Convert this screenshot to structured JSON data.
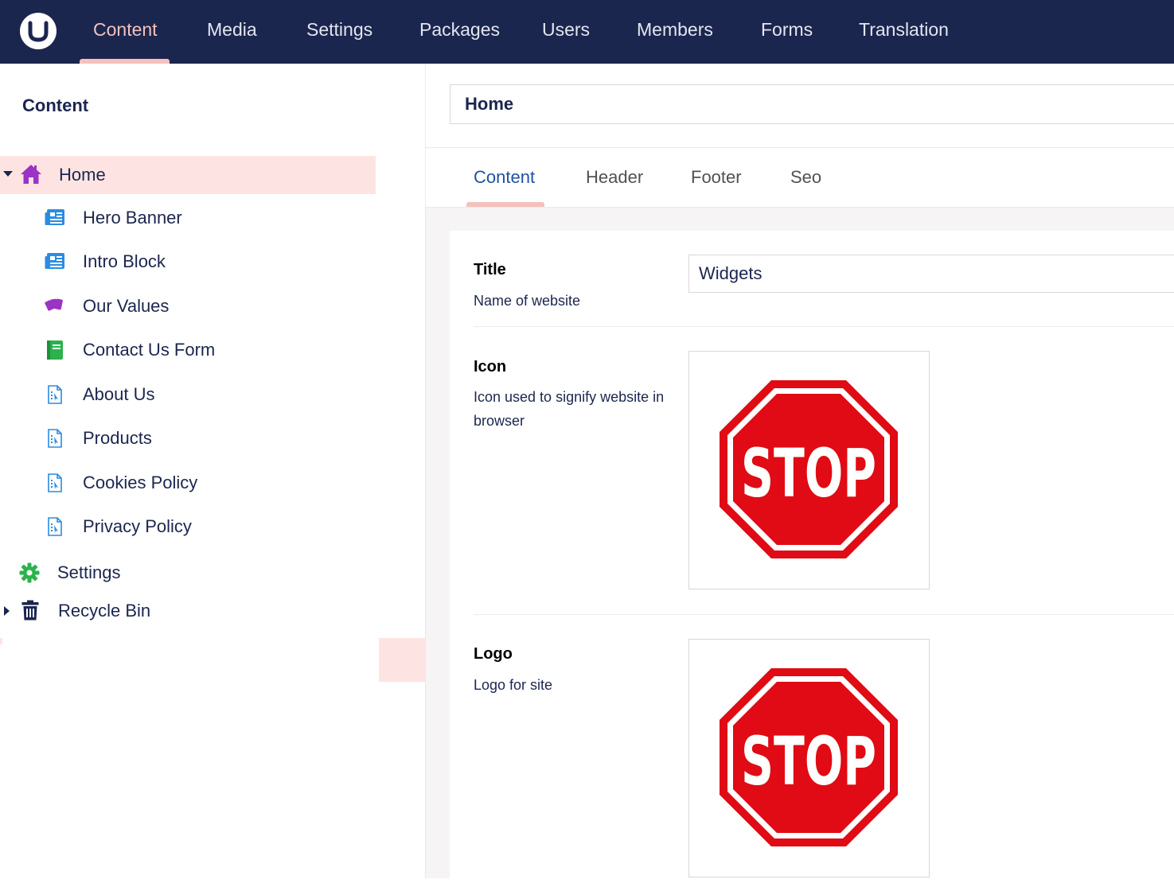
{
  "topnav": {
    "items": [
      "Content",
      "Media",
      "Settings",
      "Packages",
      "Users",
      "Members",
      "Forms",
      "Translation"
    ],
    "active": "Content"
  },
  "sidebar": {
    "title": "Content",
    "tree": {
      "home": "Home",
      "children": [
        "Hero Banner",
        "Intro Block",
        "Our Values",
        "Contact Us Form",
        "About Us",
        "Products",
        "Cookies Policy",
        "Privacy Policy"
      ],
      "settings": "Settings",
      "recycle_bin": "Recycle Bin"
    }
  },
  "editor": {
    "node_name": "Home",
    "tabs": [
      "Content",
      "Header",
      "Footer",
      "Seo"
    ],
    "active_tab": "Content",
    "properties": {
      "title": {
        "label": "Title",
        "description": "Name of website",
        "value": "Widgets"
      },
      "icon": {
        "label": "Icon",
        "description": "Icon used to signify website in browser",
        "image_text": "STOP"
      },
      "logo": {
        "label": "Logo",
        "description": "Logo for site",
        "image_text": "STOP"
      }
    }
  },
  "colors": {
    "topbar": "#1b264f",
    "accent_pink": "#f5c1bc",
    "selected_row": "#fde4e2",
    "tab_active": "#2152a3",
    "stop_red": "#e00b14"
  }
}
